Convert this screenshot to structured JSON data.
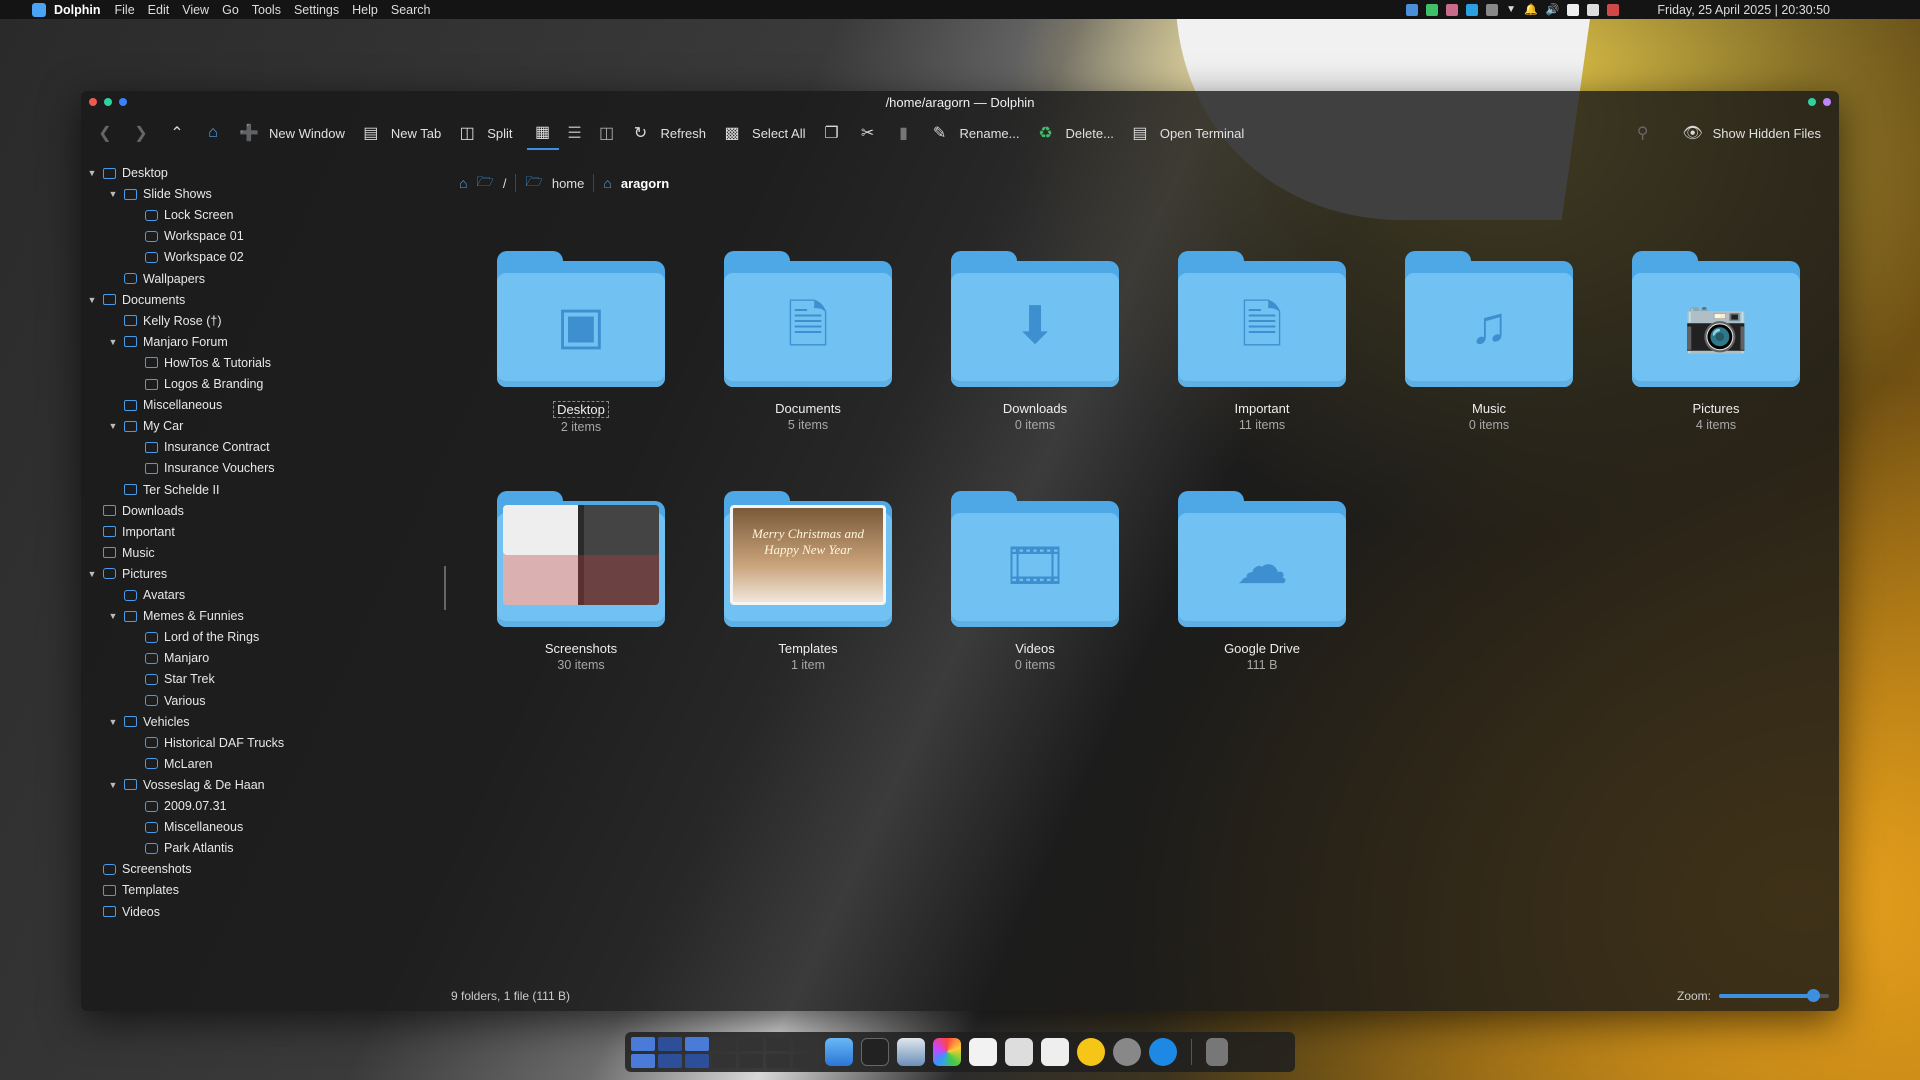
{
  "menubar": {
    "app_name": "Dolphin",
    "items": [
      "File",
      "Edit",
      "View",
      "Go",
      "Tools",
      "Settings",
      "Help",
      "Search"
    ],
    "clock": "Friday, 25 April 2025 | 20:30:50"
  },
  "window": {
    "title": "/home/aragorn — Dolphin"
  },
  "toolbar": {
    "new_window": "New Window",
    "new_tab": "New Tab",
    "split": "Split",
    "refresh": "Refresh",
    "select_all": "Select All",
    "rename": "Rename...",
    "delete": "Delete...",
    "open_terminal": "Open Terminal",
    "show_hidden": "Show Hidden Files"
  },
  "breadcrumb": {
    "root": "/",
    "home": "home",
    "current": "aragorn"
  },
  "sidebar": {
    "items": [
      {
        "label": "Desktop",
        "level": 0,
        "expanded": true,
        "icon": "folder-desktop-icon"
      },
      {
        "label": "Slide Shows",
        "level": 1,
        "expanded": true,
        "icon": "folder-video-icon"
      },
      {
        "label": "Lock Screen",
        "level": 2,
        "icon": "folder-pictures-icon"
      },
      {
        "label": "Workspace 01",
        "level": 2,
        "icon": "folder-pictures-icon"
      },
      {
        "label": "Workspace 02",
        "level": 2,
        "icon": "folder-pictures-icon"
      },
      {
        "label": "Wallpapers",
        "level": 1,
        "icon": "folder-pictures-icon"
      },
      {
        "label": "Documents",
        "level": 0,
        "expanded": true,
        "icon": "folder-documents-icon"
      },
      {
        "label": "Kelly Rose (†)",
        "level": 1,
        "icon": "folder-icon"
      },
      {
        "label": "Manjaro Forum",
        "level": 1,
        "expanded": true,
        "icon": "folder-icon"
      },
      {
        "label": "HowTos & Tutorials",
        "level": 2,
        "icon": "folder-icon"
      },
      {
        "label": "Logos & Branding",
        "level": 2,
        "icon": "folder-icon"
      },
      {
        "label": "Miscellaneous",
        "level": 1,
        "icon": "folder-icon"
      },
      {
        "label": "My Car",
        "level": 1,
        "expanded": true,
        "icon": "folder-icon"
      },
      {
        "label": "Insurance Contract",
        "level": 2,
        "icon": "folder-icon"
      },
      {
        "label": "Insurance Vouchers",
        "level": 2,
        "icon": "folder-icon"
      },
      {
        "label": "Ter Schelde II",
        "level": 1,
        "icon": "folder-icon"
      },
      {
        "label": "Downloads",
        "level": 0,
        "icon": "folder-download-icon"
      },
      {
        "label": "Important",
        "level": 0,
        "icon": "folder-documents-icon"
      },
      {
        "label": "Music",
        "level": 0,
        "icon": "folder-music-icon"
      },
      {
        "label": "Pictures",
        "level": 0,
        "expanded": true,
        "icon": "folder-pictures-icon"
      },
      {
        "label": "Avatars",
        "level": 1,
        "icon": "folder-pictures-icon"
      },
      {
        "label": "Memes & Funnies",
        "level": 1,
        "expanded": true,
        "icon": "folder-icon"
      },
      {
        "label": "Lord of the Rings",
        "level": 2,
        "icon": "folder-pictures-icon"
      },
      {
        "label": "Manjaro",
        "level": 2,
        "icon": "folder-pictures-icon"
      },
      {
        "label": "Star Trek",
        "level": 2,
        "icon": "folder-pictures-icon"
      },
      {
        "label": "Various",
        "level": 2,
        "icon": "folder-pictures-icon"
      },
      {
        "label": "Vehicles",
        "level": 1,
        "expanded": true,
        "icon": "folder-icon"
      },
      {
        "label": "Historical DAF Trucks",
        "level": 2,
        "icon": "folder-pictures-icon"
      },
      {
        "label": "McLaren",
        "level": 2,
        "icon": "folder-pictures-icon"
      },
      {
        "label": "Vosseslag & De Haan",
        "level": 1,
        "expanded": true,
        "icon": "folder-icon"
      },
      {
        "label": "2009.07.31",
        "level": 2,
        "icon": "folder-pictures-icon"
      },
      {
        "label": "Miscellaneous",
        "level": 2,
        "icon": "folder-pictures-icon"
      },
      {
        "label": "Park Atlantis",
        "level": 2,
        "icon": "folder-pictures-icon"
      },
      {
        "label": "Screenshots",
        "level": 0,
        "icon": "folder-pictures-icon"
      },
      {
        "label": "Templates",
        "level": 0,
        "icon": "folder-templates-icon"
      },
      {
        "label": "Videos",
        "level": 0,
        "icon": "folder-video-icon"
      }
    ]
  },
  "folders": [
    {
      "name": "Desktop",
      "count": "2 items",
      "glyph": "desktop-icon",
      "selected": true
    },
    {
      "name": "Documents",
      "count": "5 items",
      "glyph": "document-icon"
    },
    {
      "name": "Downloads",
      "count": "0 items",
      "glyph": "download-icon"
    },
    {
      "name": "Important",
      "count": "11 items",
      "glyph": "document-icon"
    },
    {
      "name": "Music",
      "count": "0 items",
      "glyph": "music-note-icon"
    },
    {
      "name": "Pictures",
      "count": "4 items",
      "glyph": "camera-icon"
    },
    {
      "name": "Screenshots",
      "count": "30 items",
      "glyph": "screenshots-preview"
    },
    {
      "name": "Templates",
      "count": "1 item",
      "glyph": "christmas-card-preview"
    },
    {
      "name": "Videos",
      "count": "0 items",
      "glyph": "film-icon"
    },
    {
      "name": "Google Drive",
      "count": "111 B",
      "glyph": "cloud-icon"
    }
  ],
  "status": {
    "summary": "9 folders, 1 file (111 B)",
    "zoom_label": "Zoom:",
    "zoom_fraction": 0.85
  },
  "template_card_text": "Merry Christmas and Happy New Year",
  "colors": {
    "accent": "#3d8fe0",
    "folder_front": "#71c2f2",
    "folder_back": "#4fa8e6"
  }
}
